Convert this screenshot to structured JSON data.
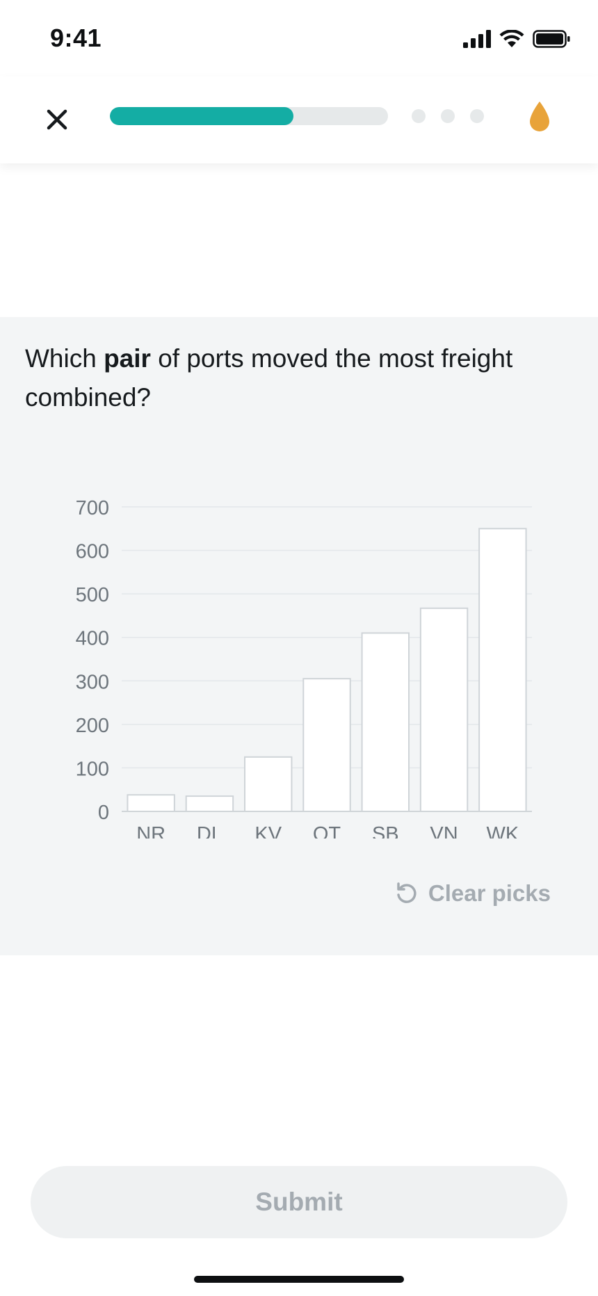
{
  "status_bar": {
    "time": "9:41",
    "icons": [
      "cellular-signal-icon",
      "wifi-icon",
      "battery-icon"
    ]
  },
  "top_bar": {
    "close_icon": "close-icon",
    "progress": 0.66,
    "upcoming_steps": 3,
    "streak_icon": "drop-icon"
  },
  "question": {
    "before": "Which ",
    "emphasis": "pair",
    "after": " of ports moved the most freight combined?"
  },
  "chart_data": {
    "type": "bar",
    "categories": [
      "NR",
      "DL",
      "KV",
      "OT",
      "SB",
      "VN",
      "WK"
    ],
    "values": [
      38,
      35,
      125,
      305,
      410,
      467,
      650
    ],
    "yticks": [
      0,
      100,
      200,
      300,
      400,
      500,
      600,
      700
    ],
    "ylim": [
      0,
      700
    ],
    "grid": true,
    "title": "",
    "xlabel": "",
    "ylabel": ""
  },
  "actions": {
    "clear_picks_label": "Clear picks",
    "submit_label": "Submit"
  },
  "colors": {
    "accent": "#14ada4",
    "streak": "#e8a33a",
    "bar_fill": "#ffffff",
    "bar_stroke": "#cfd4d8",
    "panel_bg": "#f3f5f6",
    "muted_text": "#a4abb1"
  }
}
